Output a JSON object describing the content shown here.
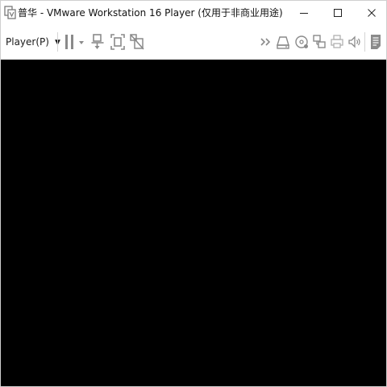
{
  "window": {
    "title": "普华 - VMware Workstation 16 Player (仅用于非商业用途)",
    "app_icon": "vmware-player-icon"
  },
  "window_controls": {
    "minimize_icon": "minimize-icon",
    "maximize_icon": "maximize-icon",
    "close_icon": "close-icon"
  },
  "toolbar": {
    "player_menu_label": "Player(P)",
    "left_icons": [
      "pause-icon",
      "dropdown-arrow-icon",
      "send-ctrl-alt-del-icon",
      "fit-guest-icon",
      "unity-icon"
    ],
    "right_icons": [
      "overflow-chevron-icon",
      "hard-disk-icon",
      "cd-dvd-icon",
      "network-adapter-icon",
      "printer-icon",
      "sound-card-icon",
      "message-log-icon"
    ]
  },
  "vm_screen": {
    "background": "#000000"
  },
  "colors": {
    "icon_gray": "#8a8a8a",
    "title_text": "#111111",
    "window_border": "#cfcfcf"
  }
}
